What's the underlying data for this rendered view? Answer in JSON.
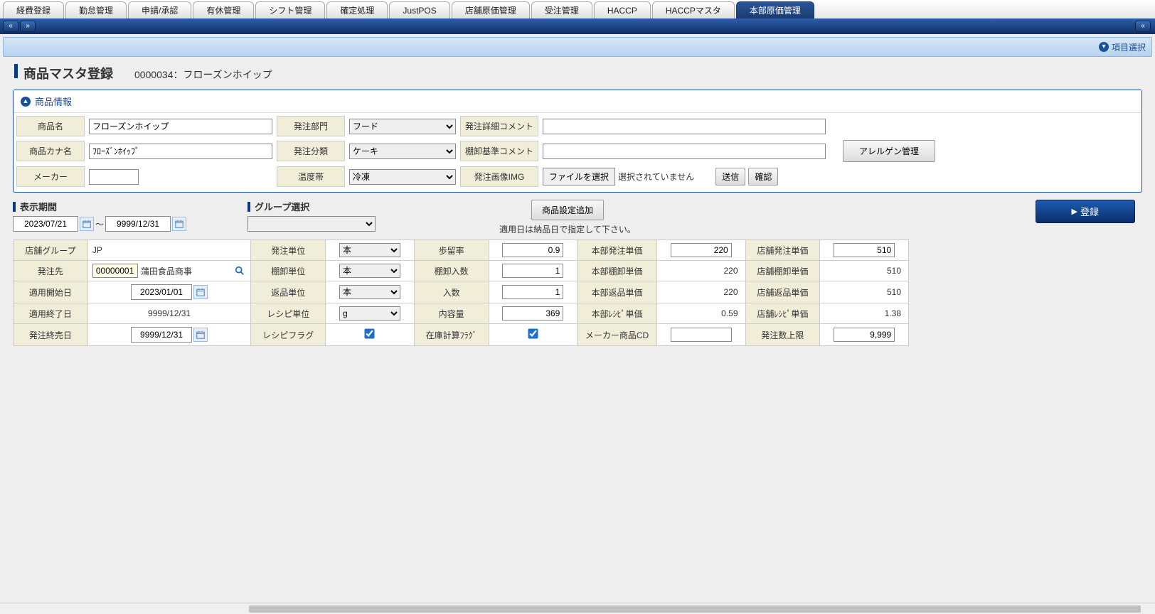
{
  "tabs": [
    "経費登録",
    "勤怠管理",
    "申請/承認",
    "有休管理",
    "シフト管理",
    "確定処理",
    "JustPOS",
    "店舗原価管理",
    "受注管理",
    "HACCP",
    "HACCPマスタ",
    "本部原価管理"
  ],
  "active_tab": 11,
  "toolbar": {
    "item_select": "項目選択"
  },
  "page": {
    "title": "商品マスタ登録",
    "subtitle": "0000034：フローズンホイップ"
  },
  "info_panel": {
    "header": "商品情報",
    "labels": {
      "product_name": "商品名",
      "product_kana": "商品カナ名",
      "maker": "メーカー",
      "order_dept": "発注部門",
      "order_class": "発注分類",
      "temp_zone": "温度帯",
      "order_detail_comment": "発注詳細コメント",
      "inventory_std_comment": "棚卸基準コメント",
      "order_image": "発注画像IMG"
    },
    "values": {
      "product_name": "フローズンホイップ",
      "product_kana": "ﾌﾛｰｽﾞﾝﾎｲｯﾌﾟ",
      "maker": "",
      "order_dept": "フード",
      "order_class": "ケーキ",
      "temp_zone": "冷凍",
      "order_detail_comment": "",
      "inventory_std_comment": "",
      "file_choose": "ファイルを選択",
      "file_status": "選択されていません",
      "send": "送信",
      "confirm": "確認"
    },
    "allergen_btn": "アレルゲン管理"
  },
  "filters": {
    "period_label": "表示期間",
    "period_from": "2023/07/21",
    "period_sep": "～",
    "period_to": "9999/12/31",
    "group_label": "グループ選択",
    "group_value": "",
    "add_setting": "商品設定追加",
    "note": "適用日は納品日で指定して下さい。",
    "register": "登録"
  },
  "grid": {
    "r1": {
      "store_group_l": "店舗グループ",
      "store_group_v": "JP",
      "order_unit_l": "発注単位",
      "order_unit_v": "本",
      "yield_l": "歩留率",
      "yield_v": "0.9",
      "hq_order_price_l": "本部発注単価",
      "hq_order_price_v": "220",
      "store_order_price_l": "店舗発注単価",
      "store_order_price_v": "510"
    },
    "r2": {
      "order_dest_l": "発注先",
      "order_dest_code": "00000001",
      "order_dest_name": "蒲田食品商事",
      "inv_unit_l": "棚卸単位",
      "inv_unit_v": "本",
      "inv_qty_l": "棚卸入数",
      "inv_qty_v": "1",
      "hq_inv_price_l": "本部棚卸単価",
      "hq_inv_price_v": "220",
      "store_inv_price_l": "店舗棚卸単価",
      "store_inv_price_v": "510"
    },
    "r3": {
      "apply_start_l": "適用開始日",
      "apply_start_v": "2023/01/01",
      "return_unit_l": "返品単位",
      "return_unit_v": "本",
      "qty_l": "入数",
      "qty_v": "1",
      "hq_return_price_l": "本部返品単価",
      "hq_return_price_v": "220",
      "store_return_price_l": "店舗返品単価",
      "store_return_price_v": "510"
    },
    "r4": {
      "apply_end_l": "適用終了日",
      "apply_end_v": "9999/12/31",
      "recipe_unit_l": "レシピ単位",
      "recipe_unit_v": "g",
      "content_l": "内容量",
      "content_v": "369",
      "hq_recipe_price_l": "本部ﾚｼﾋﾟ単価",
      "hq_recipe_price_v": "0.59",
      "store_recipe_price_l": "店舗ﾚｼﾋﾟ単価",
      "store_recipe_price_v": "1.38"
    },
    "r5": {
      "order_end_l": "発注終売日",
      "order_end_v": "9999/12/31",
      "recipe_flag_l": "レシピフラグ",
      "recipe_flag_v": true,
      "stock_calc_l": "在庫計算ﾌﾗｸﾞ",
      "stock_calc_v": true,
      "maker_cd_l": "メーカー商品CD",
      "maker_cd_v": "",
      "order_max_l": "発注数上限",
      "order_max_v": "9,999"
    }
  }
}
